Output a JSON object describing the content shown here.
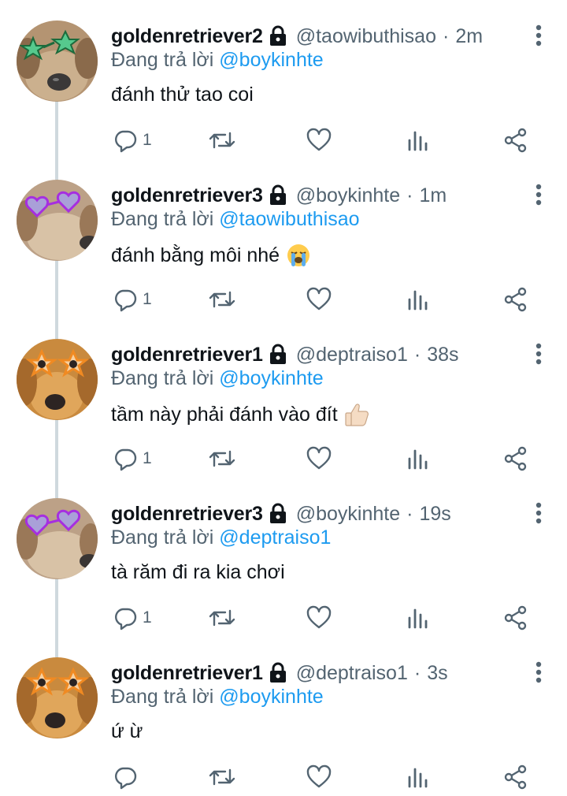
{
  "labels": {
    "replying_to": "Đang trả lời"
  },
  "colors": {
    "mention": "#1d9bf0",
    "secondary_text": "#536471",
    "thread_line": "#cfd9de"
  },
  "icons": {
    "lock": "lock-icon",
    "more": "more-vertical-icon",
    "reply": "reply-icon",
    "retweet": "retweet-icon",
    "like": "like-icon",
    "analytics": "analytics-icon",
    "share": "share-icon"
  },
  "tweets": [
    {
      "name": "goldenretriever2",
      "handle": "@taowibuthisao",
      "separator": "·",
      "time": "2m",
      "reply_to": "@boykinhte",
      "text": "đánh thử tao coi",
      "emoji": "",
      "reply_count": "1",
      "avatar": "dog-green-star-glasses"
    },
    {
      "name": "goldenretriever3",
      "handle": "@boykinhte",
      "separator": "·",
      "time": "1m",
      "reply_to": "@taowibuthisao",
      "text": "đánh bằng môi nhé",
      "emoji": "loudly-crying-face",
      "reply_count": "1",
      "avatar": "dog-purple-heart-glasses"
    },
    {
      "name": "goldenretriever1",
      "handle": "@deptraiso1",
      "separator": "·",
      "time": "38s",
      "reply_to": "@boykinhte",
      "text": "tầm này phải đánh vào đít",
      "emoji": "thumbs-up",
      "reply_count": "1",
      "avatar": "dog-orange-star-glasses"
    },
    {
      "name": "goldenretriever3",
      "handle": "@boykinhte",
      "separator": "·",
      "time": "19s",
      "reply_to": "@deptraiso1",
      "text": "tà răm đi ra kia chơi",
      "emoji": "",
      "reply_count": "1",
      "avatar": "dog-purple-heart-glasses"
    },
    {
      "name": "goldenretriever1",
      "handle": "@deptraiso1",
      "separator": "·",
      "time": "3s",
      "reply_to": "@boykinhte",
      "text": "ứ ừ",
      "emoji": "",
      "reply_count": "",
      "avatar": "dog-orange-star-glasses"
    }
  ]
}
